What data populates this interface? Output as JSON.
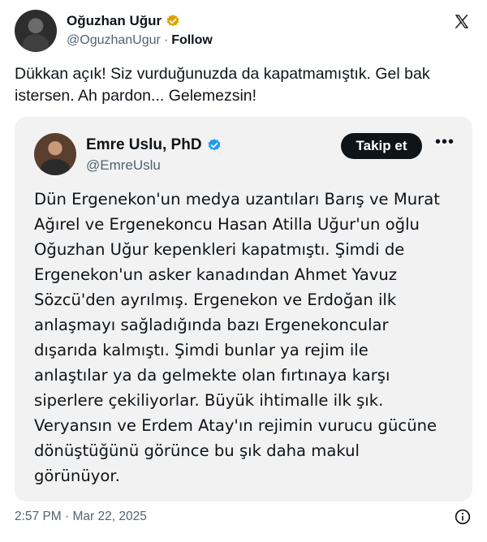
{
  "tweet": {
    "author_name": "Oğuzhan Uğur",
    "author_handle": "@OguzhanUgur",
    "separator": "·",
    "follow_label": "Follow",
    "text": "Dükkan açık! Siz vurduğunuzda da kapatmamıştık. Gel bak istersen. Ah pardon... Gelemezsin!",
    "timestamp": "2:57 PM · Mar 22, 2025"
  },
  "quote": {
    "author_name": "Emre Uslu, PhD",
    "author_handle": "@EmreUslu",
    "follow_button_label": "Takip et",
    "more_label": "•••",
    "lines": [
      "Dün Ergenekon'un medya uzantıları Barış ve Murat",
      "Ağırel ve Ergenekoncu Hasan Atilla Uğur'un oğlu",
      "Oğuzhan Uğur kepenkleri kapatmıştı.  Şimdi de",
      "Ergenekon'un asker kanadından Ahmet Yavuz",
      "Sözcü'den ayrılmış. Ergenekon ve Erdoğan ilk",
      "anlaşmayı sağladığında bazı Ergenekoncular",
      "dışarıda kalmıştı. Şimdi bunlar ya rejim ile",
      "anlaştılar ya da gelmekte olan fırtınaya karşı",
      "siperlere çekiliyorlar.  Büyük ihtimalle ilk şık.",
      "Veryansın ve Erdem Atay'ın rejimin vurucu gücüne",
      "dönüştüğünü görünce bu şık daha makul",
      "görünüyor."
    ]
  },
  "colors": {
    "verified_gold": "#d9a400",
    "verified_blue": "#1d9bf0",
    "text_primary": "#0f1419",
    "text_secondary": "#536471",
    "quote_background": "#f2f2f2"
  },
  "icons": {
    "logo": "x-logo-icon",
    "verified_main": "verified-gold-icon",
    "verified_quote": "verified-blue-icon",
    "info": "info-icon",
    "more": "more-horizontal-icon"
  }
}
